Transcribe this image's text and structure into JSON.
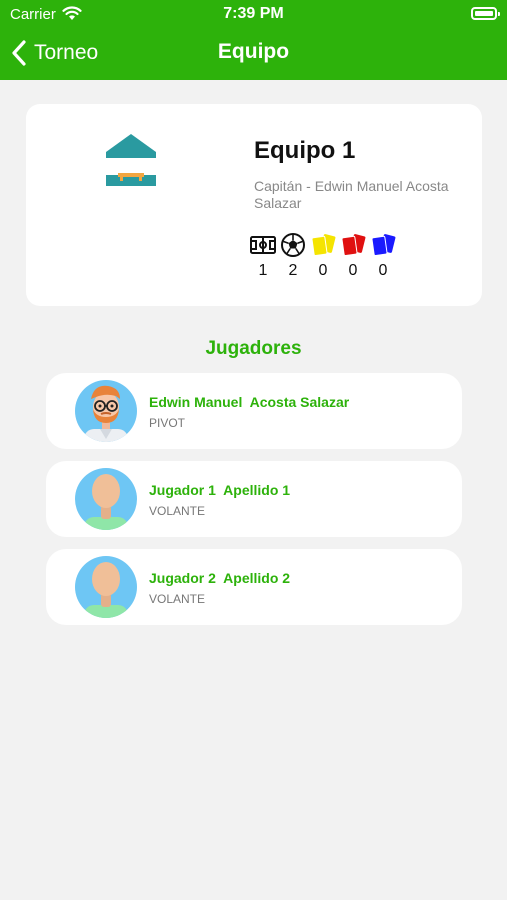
{
  "status_bar": {
    "carrier": "Carrier",
    "time": "7:39 PM"
  },
  "nav": {
    "back_label": "Torneo",
    "title": "Equipo"
  },
  "team": {
    "name": "Equipo 1",
    "captain": "Capitán - Edwin Manuel  Acosta Salazar",
    "stats": [
      {
        "icon": "pitch-icon",
        "value": "1"
      },
      {
        "icon": "soccer-ball-icon",
        "value": "2"
      },
      {
        "icon": "yellow-card-icon",
        "value": "0",
        "color": "#f5e400"
      },
      {
        "icon": "red-card-icon",
        "value": "0",
        "color": "#e01010"
      },
      {
        "icon": "blue-card-icon",
        "value": "0",
        "color": "#1a1aff"
      }
    ]
  },
  "players_section": {
    "title": "Jugadores"
  },
  "players": [
    {
      "name": "Edwin Manuel  Acosta Salazar",
      "position": "PIVOT",
      "avatar": "bearded-man-avatar"
    },
    {
      "name": "Jugador 1  Apellido 1",
      "position": "VOLANTE",
      "avatar": "default-avatar"
    },
    {
      "name": "Jugador 2  Apellido 2",
      "position": "VOLANTE",
      "avatar": "default-avatar"
    }
  ],
  "colors": {
    "primary": "#2db20b",
    "background": "#f2f2f2",
    "logo_teal": "#2a9aa0",
    "logo_orange": "#f3a640"
  }
}
